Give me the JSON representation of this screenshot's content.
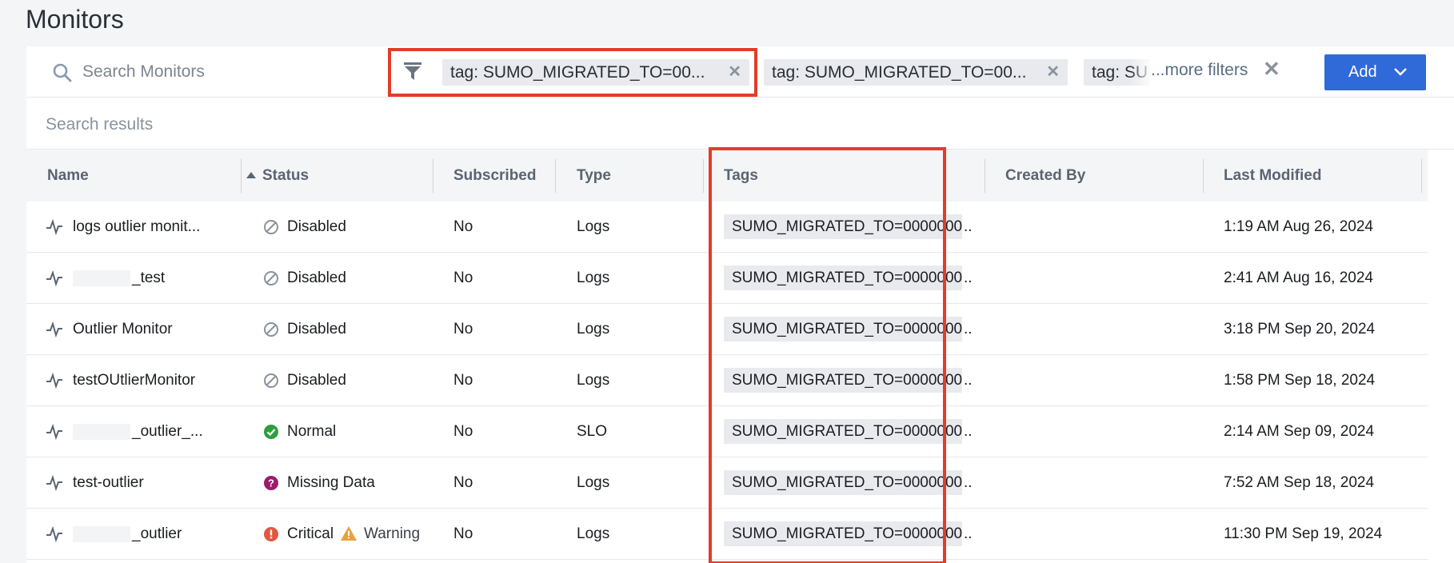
{
  "page": {
    "title": "Monitors"
  },
  "toolbar": {
    "search_placeholder": "Search Monitors",
    "filters": [
      {
        "label": "tag: SUMO_MIGRATED_TO=00..."
      },
      {
        "label": "tag: SUMO_MIGRATED_TO=00..."
      },
      {
        "label": "tag: SU"
      }
    ],
    "more_filters": "...more filters",
    "add_label": "Add"
  },
  "results": {
    "label": "Search results"
  },
  "table": {
    "columns": {
      "name": "Name",
      "status": "Status",
      "subscribed": "Subscribed",
      "type": "Type",
      "tags": "Tags",
      "created_by": "Created By",
      "last_modified": "Last Modified"
    },
    "rows": [
      {
        "name": "logs outlier monit...",
        "status": "Disabled",
        "subscribed": "No",
        "type": "Logs",
        "tag": "SUMO_MIGRATED_TO=0000000",
        "more": "..",
        "created_by": "",
        "last_modified": "1:19 AM Aug 26, 2024"
      },
      {
        "name": "_test",
        "status": "Disabled",
        "subscribed": "No",
        "type": "Logs",
        "tag": "SUMO_MIGRATED_TO=0000000",
        "more": "..",
        "created_by": "",
        "last_modified": "2:41 AM Aug 16, 2024"
      },
      {
        "name": "Outlier Monitor",
        "status": "Disabled",
        "subscribed": "No",
        "type": "Logs",
        "tag": "SUMO_MIGRATED_TO=0000000",
        "more": "..",
        "created_by": "",
        "last_modified": "3:18 PM Sep 20, 2024"
      },
      {
        "name": "testOUtlierMonitor",
        "status": "Disabled",
        "subscribed": "No",
        "type": "Logs",
        "tag": "SUMO_MIGRATED_TO=0000000",
        "more": "..",
        "created_by": "",
        "last_modified": "1:58 PM Sep 18, 2024"
      },
      {
        "name": "_outlier_...",
        "status": "Normal",
        "subscribed": "No",
        "type": "SLO",
        "tag": "SUMO_MIGRATED_TO=0000000",
        "more": "..",
        "created_by": "",
        "last_modified": "2:14 AM Sep 09, 2024"
      },
      {
        "name": "test-outlier",
        "status": "Missing Data",
        "subscribed": "No",
        "type": "Logs",
        "tag": "SUMO_MIGRATED_TO=0000000",
        "more": "..",
        "created_by": "",
        "last_modified": "7:52 AM Sep 18, 2024"
      },
      {
        "name": "_outlier",
        "status": "Critical",
        "status2": "Warning",
        "subscribed": "No",
        "type": "Logs",
        "tag": "SUMO_MIGRATED_TO=0000000",
        "more": "..",
        "created_by": "",
        "last_modified": "11:30 PM Sep 19, 2024"
      }
    ]
  },
  "colors": {
    "accent": "#2f6ad8",
    "highlight": "#e23d28",
    "normal": "#2e9e3e",
    "missing_data": "#9b1a6e",
    "critical": "#e3573f",
    "warning": "#e6a23c",
    "disabled": "#8a929c"
  },
  "icons": [
    "search-icon",
    "filter-icon",
    "close-icon",
    "chevron-down-icon",
    "monitor-icon",
    "disabled-icon",
    "check-circle-icon",
    "question-circle-icon",
    "exclamation-circle-icon",
    "warning-triangle-icon"
  ]
}
